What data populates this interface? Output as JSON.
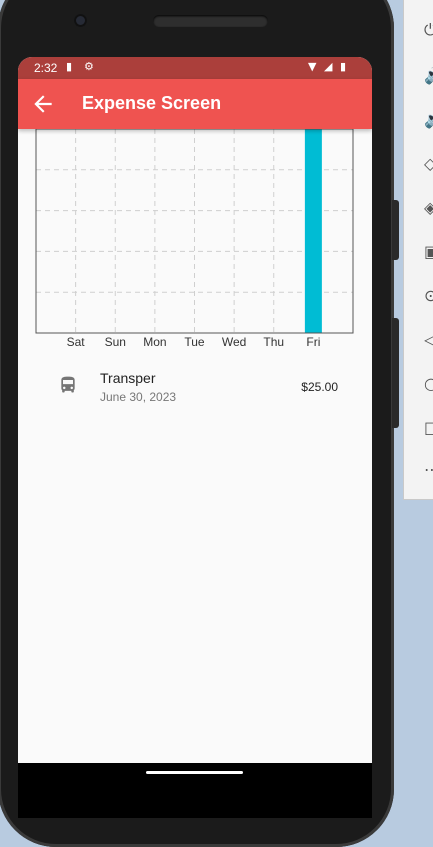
{
  "status_bar": {
    "time": "2:32"
  },
  "app_bar": {
    "title": "Expense Screen"
  },
  "chart_data": {
    "type": "bar",
    "categories": [
      "Sat",
      "Sun",
      "Mon",
      "Tue",
      "Wed",
      "Thu",
      "Fri"
    ],
    "values": [
      0,
      0,
      0,
      0,
      0,
      0,
      25
    ],
    "ylim": [
      0,
      25
    ],
    "grid": true,
    "bar_color": "#00bcd4"
  },
  "transactions": [
    {
      "title": "Transper",
      "date": "June 30, 2023",
      "amount": "$25.00",
      "icon": "bus-icon"
    }
  ],
  "colors": {
    "app_bar": "#ef5350",
    "status_bar": "#ab3f3b",
    "accent": "#00bcd4"
  }
}
